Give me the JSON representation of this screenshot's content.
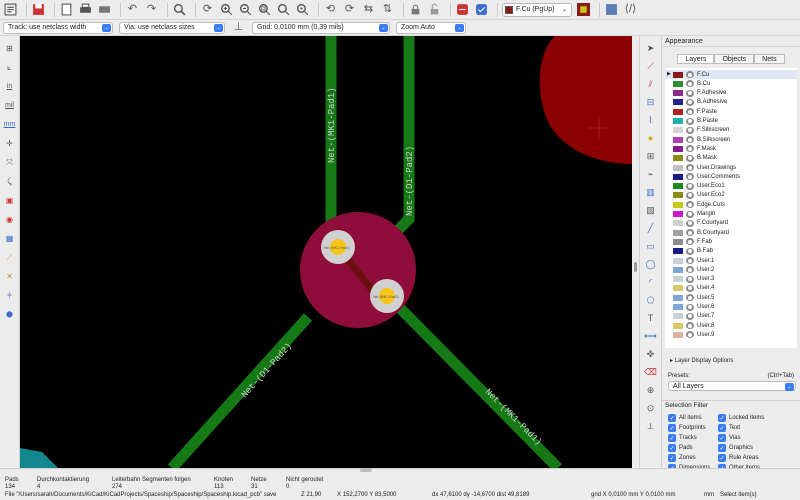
{
  "toolbar": {
    "icons": [
      "board-setup-icon",
      "save-icon",
      "page-settings-icon",
      "print-icon",
      "plot-icon",
      "undo-icon",
      "redo-icon",
      "find-icon",
      "refresh-icon",
      "zoom-in-icon",
      "zoom-out-icon",
      "zoom-fit-icon",
      "zoom-selection-icon",
      "zoom-tool-icon",
      "rotate-ccw-icon",
      "rotate-cw-icon",
      "mirror-icon",
      "flip-icon",
      "lock-icon",
      "unlock-icon",
      "netlist-icon",
      "drc-icon",
      "layer-pair-icon",
      "scripting-icon",
      "footprint-editor-icon"
    ],
    "active_layer": "F.Cu (PgUp)",
    "active_layer_color": "#8b1a1a"
  },
  "toolbar2": {
    "track": "Track: use netclass width",
    "via": "Via: use netclass sizes",
    "grid": "Grid: 0,0100 mm (0,39 mils)",
    "zoom": "Zoom Auto"
  },
  "left_tools": [
    "show-grid-icon",
    "polar-coords-icon",
    "inch-units-label",
    "in",
    "mil",
    "mm",
    "cursor-icon",
    "ratsnest-icon",
    "curved-ratsnest-icon",
    "show-pads-icon",
    "show-vias-icon",
    "zone-fill-icon",
    "zone-outline-icon",
    "track-outline-icon",
    "high-contrast-icon",
    "layers-manager-icon"
  ],
  "units": {
    "in": "in",
    "mil": "mil",
    "mm": "mm"
  },
  "canvas": {
    "background": "#000000",
    "labels": {
      "mk1_top": "Net-(MK1-Pad1)",
      "d1_top": "Net-(D1-Pad2)",
      "d1_bottom": "Net-(D1-Pad2)",
      "mk1_bottom": "Net-(MK1-Pad1)",
      "pad1": "Net-(MK1-Pad1)",
      "pad2": "Net-(MK1-Pad2)"
    },
    "colors": {
      "track": "#157a15",
      "zone": "#8e0d3a",
      "zone_tr": "#8b0000",
      "teal": "#12888e",
      "pad": "#f5c518",
      "pad_ring": "#d0d0d0"
    }
  },
  "right_tools": [
    "select-icon",
    "route-track-icon",
    "route-diff-pair-icon",
    "tune-length-icon",
    "tune-skew-icon",
    "add-via-icon",
    "add-footprint-icon",
    "microwave-icon",
    "add-zone-icon",
    "rule-area-icon",
    "add-line-icon",
    "add-rect-icon",
    "add-circle-icon",
    "add-arc-icon",
    "add-polygon-icon",
    "add-text-icon",
    "add-dimension-icon",
    "add-target-icon",
    "delete-icon",
    "grid-origin-icon",
    "set-origin-icon",
    "measure-icon"
  ],
  "panel": {
    "title": "Appearance",
    "tabs": [
      "Layers",
      "Objects",
      "Nets"
    ],
    "layers": [
      {
        "name": "F.Cu",
        "color": "#8b1a1a"
      },
      {
        "name": "B.Cu",
        "color": "#2e8b2e"
      },
      {
        "name": "F.Adhesive",
        "color": "#8b2e8b"
      },
      {
        "name": "B.Adhesive",
        "color": "#22228b"
      },
      {
        "name": "F.Paste",
        "color": "#b22222"
      },
      {
        "name": "B.Paste",
        "color": "#20b2aa"
      },
      {
        "name": "F.Silkscreen",
        "color": "#d4d4d4"
      },
      {
        "name": "B.Silkscreen",
        "color": "#b040b0"
      },
      {
        "name": "F.Mask",
        "color": "#8b1a8b"
      },
      {
        "name": "B.Mask",
        "color": "#8b8b1a"
      },
      {
        "name": "User.Drawings",
        "color": "#c0c0c0"
      },
      {
        "name": "User.Comments",
        "color": "#1a1a8b"
      },
      {
        "name": "User.Eco1",
        "color": "#1a8b1a"
      },
      {
        "name": "User.Eco2",
        "color": "#8b8b1a"
      },
      {
        "name": "Edge.Cuts",
        "color": "#c8c81a"
      },
      {
        "name": "Margin",
        "color": "#c81ac8"
      },
      {
        "name": "F.Courtyard",
        "color": "#d0d0d0"
      },
      {
        "name": "B.Courtyard",
        "color": "#a0a0a0"
      },
      {
        "name": "F.Fab",
        "color": "#8b8b8b"
      },
      {
        "name": "B.Fab",
        "color": "#1a1a8b"
      },
      {
        "name": "User.1",
        "color": "#c8d0d8"
      },
      {
        "name": "User.2",
        "color": "#7ea6d8"
      },
      {
        "name": "User.3",
        "color": "#c8d0d8"
      },
      {
        "name": "User.4",
        "color": "#d8c86a"
      },
      {
        "name": "User.5",
        "color": "#7ea6d8"
      },
      {
        "name": "User.6",
        "color": "#7ea6d8"
      },
      {
        "name": "User.7",
        "color": "#c8d0d8"
      },
      {
        "name": "User.8",
        "color": "#d8c86a"
      },
      {
        "name": "User.9",
        "color": "#e0b0a0"
      }
    ],
    "layer_display_options": "Layer Display Options",
    "presets_label": "Presets:",
    "presets_hint": "(Ctrl+Tab)",
    "presets_value": "All Layers",
    "selection_filter_title": "Selection Filter",
    "filters_left": [
      "All items",
      "Footprints",
      "Tracks",
      "Pads",
      "Zones",
      "Dimensions"
    ],
    "filters_right": [
      "Locked items",
      "Text",
      "Vias",
      "Graphics",
      "Rule Areas",
      "Other items"
    ]
  },
  "status": {
    "headers": [
      "Pads",
      "Durchkontaktierung",
      "Leiterbahn Segmenten folgen",
      "Knoten",
      "Netze",
      "Nicht geroutet"
    ],
    "values": [
      "134",
      "4",
      "274",
      "113",
      "31",
      "0"
    ],
    "file": "File \"/Users/sarah/Documents/KiCad/KiCadProjects/Spaceship/Spaceship/Spaceship.kicad_pcb\" save",
    "z": "Z 21,90",
    "xy": "X 152,2700  Y 83,5000",
    "delta": "dx 47,6100  dy -14,6700  dist 49,8189",
    "grid": "grid X 0,0100 mm  Y 0,0100 mm",
    "units": "mm",
    "mode": "Select item(s)"
  }
}
